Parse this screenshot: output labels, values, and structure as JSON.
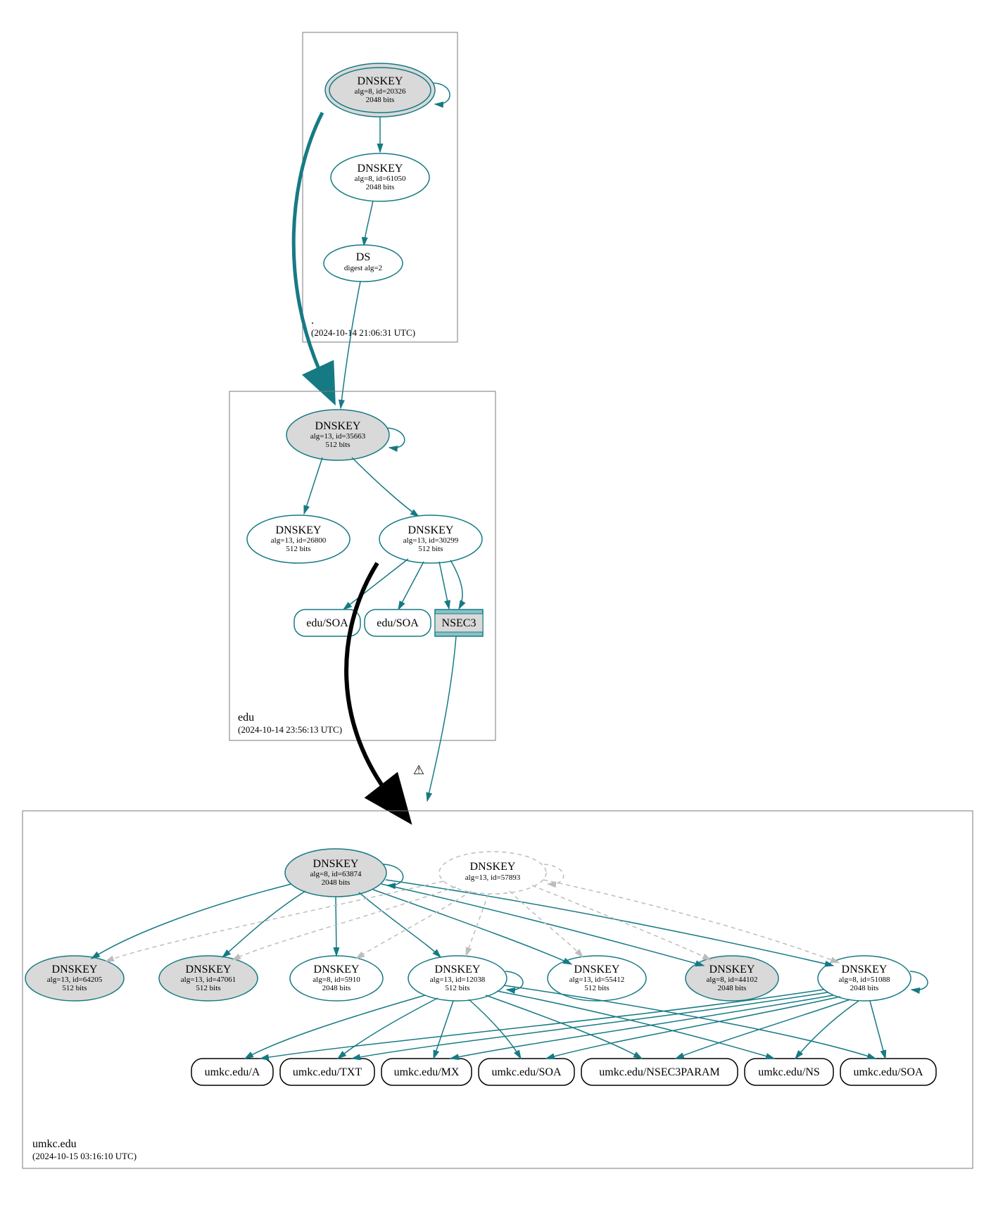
{
  "zones": {
    "root": {
      "label": ".",
      "date": "(2024-10-14 21:06:31 UTC)"
    },
    "edu": {
      "label": "edu",
      "date": "(2024-10-14 23:56:13 UTC)"
    },
    "umkc": {
      "label": "umkc.edu",
      "date": "(2024-10-15 03:16:10 UTC)"
    }
  },
  "nodes": {
    "root_ksk": {
      "t": "DNSKEY",
      "s": "alg=8, id=20326",
      "b": "2048 bits"
    },
    "root_zsk": {
      "t": "DNSKEY",
      "s": "alg=8, id=61050",
      "b": "2048 bits"
    },
    "root_ds": {
      "t": "DS",
      "s": "digest alg=2"
    },
    "edu_ksk": {
      "t": "DNSKEY",
      "s": "alg=13, id=35663",
      "b": "512 bits"
    },
    "edu_zsk1": {
      "t": "DNSKEY",
      "s": "alg=13, id=26800",
      "b": "512 bits"
    },
    "edu_zsk2": {
      "t": "DNSKEY",
      "s": "alg=13, id=30299",
      "b": "512 bits"
    },
    "edu_soa1": {
      "t": "edu/SOA"
    },
    "edu_soa2": {
      "t": "edu/SOA"
    },
    "edu_nsec3": {
      "t": "NSEC3"
    },
    "u_ksk": {
      "t": "DNSKEY",
      "s": "alg=8, id=63874",
      "b": "2048 bits"
    },
    "u_kd": {
      "t": "DNSKEY",
      "s": "alg=13, id=57893"
    },
    "u_k1": {
      "t": "DNSKEY",
      "s": "alg=13, id=64205",
      "b": "512 bits"
    },
    "u_k2": {
      "t": "DNSKEY",
      "s": "alg=13, id=47061",
      "b": "512 bits"
    },
    "u_k3": {
      "t": "DNSKEY",
      "s": "alg=8, id=5910",
      "b": "2048 bits"
    },
    "u_k4": {
      "t": "DNSKEY",
      "s": "alg=13, id=12038",
      "b": "512 bits"
    },
    "u_k5": {
      "t": "DNSKEY",
      "s": "alg=13, id=55412",
      "b": "512 bits"
    },
    "u_k6": {
      "t": "DNSKEY",
      "s": "alg=8, id=44102",
      "b": "2048 bits"
    },
    "u_k7": {
      "t": "DNSKEY",
      "s": "alg=8, id=51088",
      "b": "2048 bits"
    },
    "u_a": {
      "t": "umkc.edu/A"
    },
    "u_txt": {
      "t": "umkc.edu/TXT"
    },
    "u_mx": {
      "t": "umkc.edu/MX"
    },
    "u_soa": {
      "t": "umkc.edu/SOA"
    },
    "u_np": {
      "t": "umkc.edu/NSEC3PARAM"
    },
    "u_ns": {
      "t": "umkc.edu/NS"
    },
    "u_soa2": {
      "t": "umkc.edu/SOA"
    }
  },
  "warning": "⚠"
}
